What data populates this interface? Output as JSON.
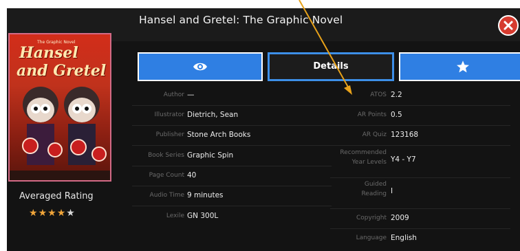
{
  "title": "Hansel and Gretel: The Graphic Novel",
  "cover": {
    "series_text": "The Graphic Novel",
    "title_line1": "Hansel",
    "title_line2": "and Gretel"
  },
  "rating": {
    "label": "Averaged Rating",
    "filled_stars": 4,
    "total_stars": 5
  },
  "buttons": {
    "details_label": "Details"
  },
  "details_left": [
    {
      "label": "Author",
      "value": "—"
    },
    {
      "label": "Illustrator",
      "value": "Dietrich, Sean"
    },
    {
      "label": "Publisher",
      "value": "Stone Arch Books"
    },
    {
      "label": "Book Series",
      "value": "Graphic Spin"
    },
    {
      "label": "Page Count",
      "value": "40"
    },
    {
      "label": "Audio Time",
      "value": "9 minutes"
    },
    {
      "label": "Lexile",
      "value": "GN 300L"
    }
  ],
  "details_right": [
    {
      "label": "ATOS",
      "value": "2.2"
    },
    {
      "label": "AR Points",
      "value": "0.5"
    },
    {
      "label": "AR Quiz",
      "value": "123168"
    },
    {
      "label_line1": "Recommended",
      "label_line2": "Year Levels",
      "value": "Y4 - Y7"
    },
    {
      "label_line1": "Guided",
      "label_line2": "Reading",
      "value": "I"
    },
    {
      "label": "Copyright",
      "value": "2009"
    },
    {
      "label": "Language",
      "value": "English"
    }
  ],
  "colors": {
    "accent_blue": "#2f7fe3",
    "close_red": "#d63b2f",
    "star_gold": "#f0a53a",
    "annotation_arrow": "#e8a21a"
  },
  "icons": [
    "eye-icon",
    "star-icon",
    "close-icon"
  ]
}
